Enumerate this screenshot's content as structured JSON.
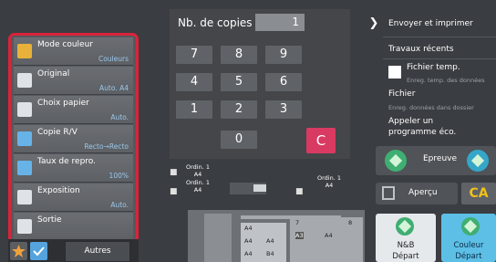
{
  "settings": {
    "items": [
      {
        "label": "Mode couleur",
        "value": "Couleurs",
        "icon": "color-mode-icon",
        "color": "#e8b23a"
      },
      {
        "label": "Original",
        "value": "Auto. A4",
        "icon": "original-icon",
        "color": "#dfe3e8"
      },
      {
        "label": "Choix papier",
        "value": "Auto.",
        "icon": "paper-select-icon",
        "color": "#dfe3e8"
      },
      {
        "label": "Copie R/V",
        "value": "Recto→Recto",
        "icon": "duplex-icon",
        "color": "#67b3e8"
      },
      {
        "label": "Taux de repro.",
        "value": "100%",
        "icon": "zoom-icon",
        "color": "#67b3e8"
      },
      {
        "label": "Exposition",
        "value": "Auto.",
        "icon": "exposure-icon",
        "color": "#dfe3e8"
      },
      {
        "label": "Sortie",
        "value": "",
        "icon": "output-icon",
        "color": "#dfe3e8"
      }
    ],
    "autres_label": "Autres"
  },
  "keypad": {
    "copies_label": "Nb. de copies",
    "copies_value": "1",
    "keys": [
      "7",
      "8",
      "9",
      "4",
      "5",
      "6",
      "1",
      "2",
      "3",
      "0"
    ],
    "clear_label": "C"
  },
  "menu": {
    "send_print": "Envoyer et imprimer",
    "recent_jobs": "Travaux récents",
    "temp_file": "Fichier temp.",
    "temp_file_sub": "Enreg. temp. des données",
    "file": "Fichier",
    "file_sub": "Enreg. données dans dossier",
    "eco_line1": "Appeler un",
    "eco_line2": "programme éco."
  },
  "actions": {
    "proof_label": "Epreuve",
    "preview_label": "Aperçu",
    "ca_label": "CA",
    "bw_start_line1": "N&B",
    "bw_start_line2": "Départ",
    "color_start_line1": "Couleur",
    "color_start_line2": "Départ"
  },
  "machine": {
    "doc_labels": [
      {
        "line1": "Ordin. 1",
        "line2": "A4"
      },
      {
        "line1": "Ordin. 1",
        "line2": "A4"
      },
      {
        "line1": "Ordin. 1",
        "line2": "A4"
      }
    ],
    "tray_labels": [
      "A4",
      "A4",
      "A4",
      "A4",
      "B4",
      "A3",
      "A4"
    ],
    "tray_numbers": [
      "1",
      "2",
      "3",
      "4",
      "7",
      "8"
    ]
  },
  "colors": {
    "highlight": "#d8243b",
    "clear": "#d93a62",
    "ca": "#f0c11a",
    "start_color": "#5dbfe6",
    "go_green": "#3fae72"
  }
}
